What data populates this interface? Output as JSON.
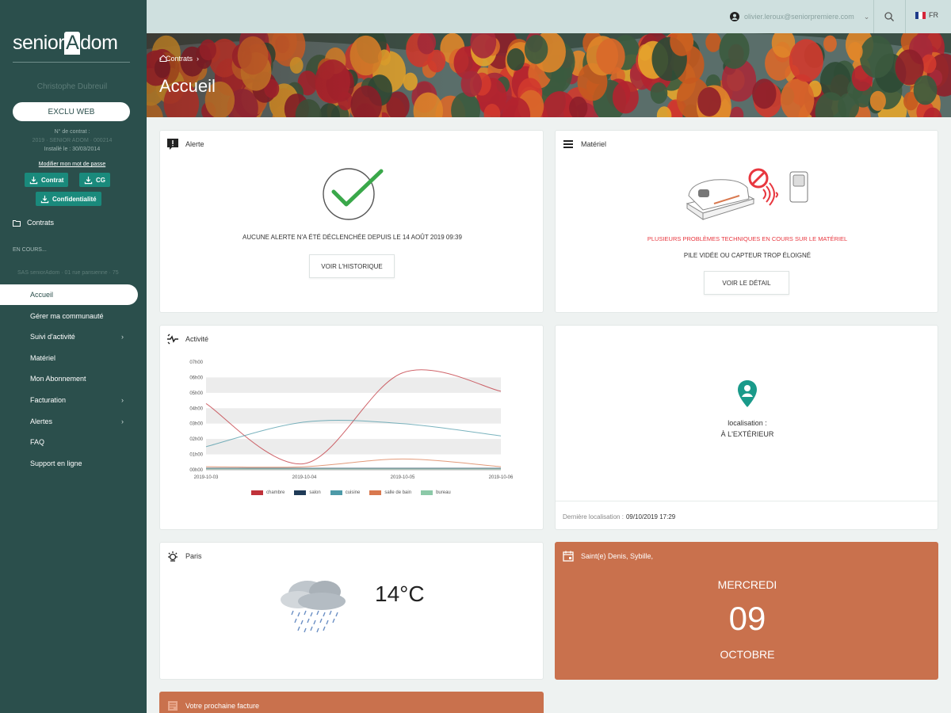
{
  "brand": {
    "logo_text": "seniorAdom"
  },
  "sidebar": {
    "user_name": "Christophe Dubreuil",
    "exclu_label": "EXCLU WEB",
    "contract_no": "N° de contrat :",
    "contract_detail": "2019 · SENIOR ADOM · 000214",
    "installed": "Installé le : 30/03/2014",
    "modify_link": "Modifier mon mot de passe",
    "downloads": [
      "Contrat",
      "CG",
      "Confidentialité"
    ],
    "contrats_label": "Contrats",
    "en_cours": "EN COURS...",
    "contract_row": "SAS seniorAdom · 01 rue parisienne · 75",
    "nav": [
      {
        "label": "Accueil",
        "active": true,
        "chevron": false
      },
      {
        "label": "Gérer ma communauté",
        "active": false,
        "chevron": false
      },
      {
        "label": "Suivi d'activité",
        "active": false,
        "chevron": true
      },
      {
        "label": "Matériel",
        "active": false,
        "chevron": false
      },
      {
        "label": "Mon Abonnement",
        "active": false,
        "chevron": false
      },
      {
        "label": "Facturation",
        "active": false,
        "chevron": true
      },
      {
        "label": "Alertes",
        "active": false,
        "chevron": true
      },
      {
        "label": "FAQ",
        "active": false,
        "chevron": false
      },
      {
        "label": "Support en ligne",
        "active": false,
        "chevron": false
      }
    ]
  },
  "topbar": {
    "user_email": "olivier.leroux@seniorpremiere.com",
    "lang": "FR"
  },
  "hero": {
    "breadcrumb": "Contrats",
    "title": "Accueil"
  },
  "alerte": {
    "title": "Alerte",
    "message": "AUCUNE ALERTE N'A ÉTÉ DÉCLENCHÉE DEPUIS LE 14 AOÛT 2019 09:39",
    "button": "VOIR L'HISTORIQUE"
  },
  "materiel": {
    "title": "Matériel",
    "warning": "PLUSIEURS PROBLÈMES TECHNIQUES EN COURS SUR LE MATÉRIEL",
    "detail": "PILE VIDÉE OU CAPTEUR TROP ÉLOIGNÉ",
    "button": "VOIR LE DÉTAIL"
  },
  "activite": {
    "title": "Activité"
  },
  "chart_data": {
    "type": "line",
    "x": [
      "2019-10-03",
      "2019-10-04",
      "2019-10-05",
      "2019-10-06"
    ],
    "y_ticks": [
      "00h00",
      "01h00",
      "02h00",
      "03h00",
      "04h00",
      "05h00",
      "06h00",
      "07h00"
    ],
    "ylim": [
      0,
      7
    ],
    "grid": "horizontal bands",
    "legend_position": "bottom",
    "series": [
      {
        "name": "chambre",
        "color": "#c0323a",
        "values": [
          4.3,
          0.4,
          6.3,
          5.1
        ]
      },
      {
        "name": "salon",
        "color": "#1f3b57",
        "values": [
          0.1,
          0.1,
          0.1,
          0.1
        ]
      },
      {
        "name": "cuisine",
        "color": "#4d9aa8",
        "values": [
          1.5,
          3.1,
          3.0,
          2.2
        ]
      },
      {
        "name": "salle de bain",
        "color": "#d9794f",
        "values": [
          0.2,
          0.2,
          0.7,
          0.2
        ]
      },
      {
        "name": "bureau",
        "color": "#8cc9a8",
        "values": [
          0.05,
          0.05,
          0.05,
          0.05
        ]
      }
    ]
  },
  "localisation": {
    "label": "localisation :",
    "value": "À L'EXTÉRIEUR",
    "footer_label": "Dernière localisation :",
    "footer_value": "09/10/2019 17:29"
  },
  "meteo": {
    "city": "Paris",
    "temp": "14°C"
  },
  "fete": {
    "title": "Saint(e) Denis, Sybille,",
    "day_name": "MERCREDI",
    "day": "09",
    "month": "OCTOBRE"
  },
  "facture": {
    "title": "Votre prochaine facture"
  },
  "colors": {
    "sidebar": "#2b4f4c",
    "accent": "#1a8a7c",
    "orange": "#c9714d",
    "check": "#3aa84a",
    "warning": "#e8373f"
  }
}
